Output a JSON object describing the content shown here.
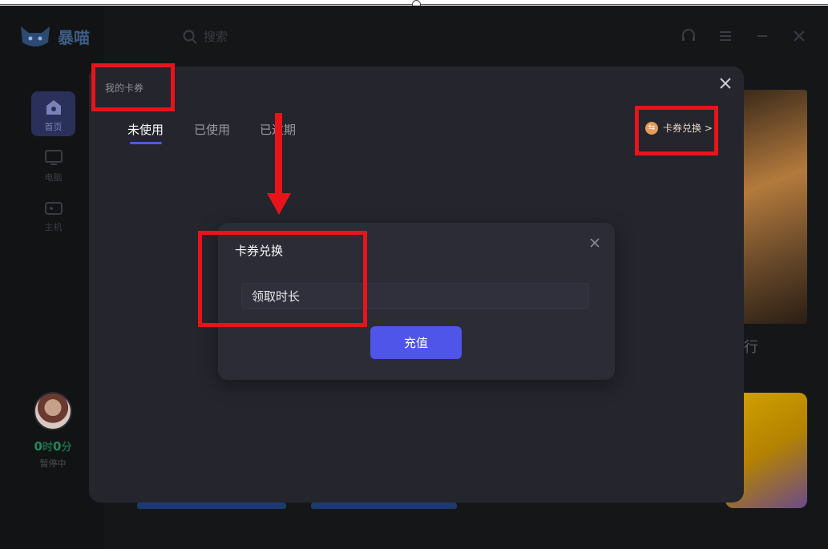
{
  "app": {
    "brand_name": "暴喵",
    "search_placeholder": "搜索",
    "sidebar": [
      {
        "label": "首页",
        "icon": "home-icon",
        "active": true
      },
      {
        "label": "电脑",
        "icon": "monitor-icon",
        "active": false
      },
      {
        "label": "主机",
        "icon": "gamepad-icon",
        "active": false
      }
    ],
    "user": {
      "hours": "0",
      "hours_unit": "时",
      "minutes": "0",
      "minutes_unit": "分",
      "status": "暂停中"
    },
    "background_text": "行",
    "top_icons": [
      "headset-icon",
      "list-icon",
      "minimize-icon",
      "close-icon"
    ]
  },
  "coupon_dialog": {
    "title": "我的卡券",
    "tabs": [
      {
        "label": "未使用",
        "active": true
      },
      {
        "label": "已使用",
        "active": false
      },
      {
        "label": "已过期",
        "active": false
      }
    ],
    "exchange_link": "卡券兑换 >"
  },
  "exchange_dialog": {
    "title": "卡券兑换",
    "input_value": "领取时长",
    "button_label": "充值"
  },
  "colors": {
    "accent": "#4e55e8",
    "annotation": "#e8141a",
    "time_green": "#1e8a5c"
  }
}
